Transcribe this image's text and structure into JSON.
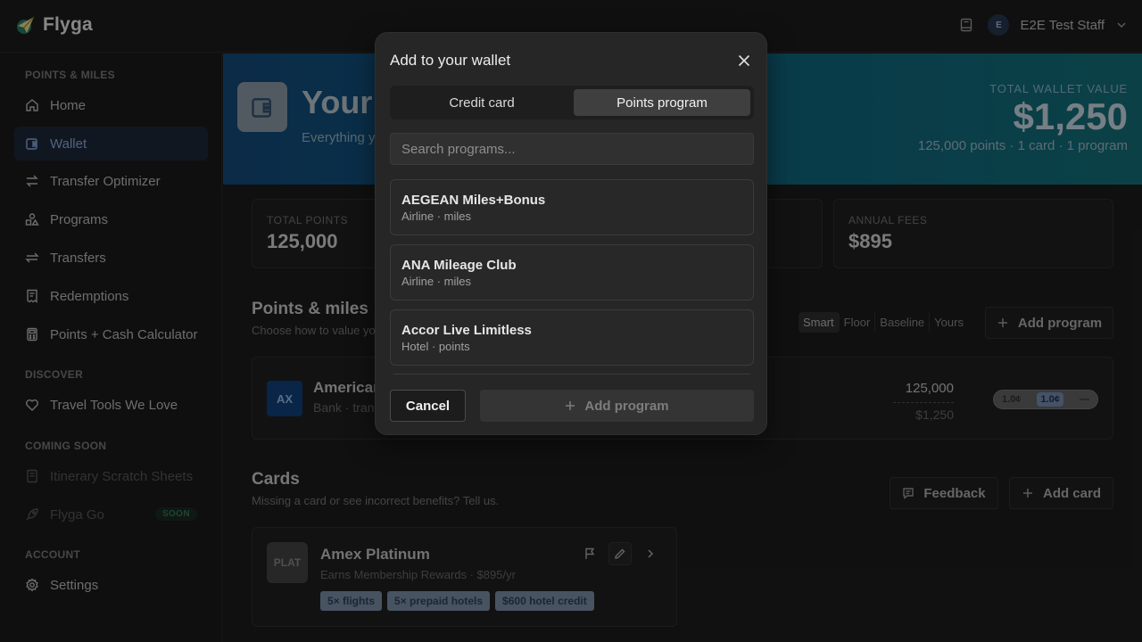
{
  "brand": {
    "name": "Flyga",
    "logo_icon": "paper-plane-globe-icon"
  },
  "topbar": {
    "user_initial": "E",
    "user_name": "E2E Test Staff"
  },
  "sidebar": {
    "sections": [
      {
        "title": "POINTS & MILES"
      },
      {
        "title": "DISCOVER"
      },
      {
        "title": "COMING SOON"
      },
      {
        "title": "ACCOUNT"
      }
    ],
    "items": [
      {
        "label": "Home",
        "icon": "home-icon"
      },
      {
        "label": "Wallet",
        "icon": "wallet-icon",
        "active": true
      },
      {
        "label": "Transfer Optimizer",
        "icon": "arrows-exchange-icon"
      },
      {
        "label": "Programs",
        "icon": "shapes-icon"
      },
      {
        "label": "Transfers",
        "icon": "transfer-icon"
      },
      {
        "label": "Redemptions",
        "icon": "receipt-icon"
      },
      {
        "label": "Points + Cash Calculator",
        "icon": "calculator-icon"
      },
      {
        "label": "Travel Tools We Love",
        "icon": "heart-icon"
      },
      {
        "label": "Itinerary Scratch Sheets",
        "icon": "notebook-icon"
      },
      {
        "label": "Flyga Go",
        "icon": "rocket-icon",
        "badge": "SOON"
      },
      {
        "label": "Settings",
        "icon": "gear-icon"
      }
    ]
  },
  "hero": {
    "title": "Your",
    "subtitle": "Everything y",
    "value_label": "TOTAL WALLET VALUE",
    "value": "$1,250",
    "detail": "125,000 points · 1 card · 1 program"
  },
  "stats": [
    {
      "label": "TOTAL POINTS",
      "value": "125,000"
    },
    {
      "label": "ANNUAL FEES",
      "value": "$895"
    }
  ],
  "points_section": {
    "title": "Points & miles",
    "subtitle": "Choose how to value yo",
    "modes": [
      "Smart",
      "Floor",
      "Baseline",
      "Yours"
    ],
    "active_mode": "Smart",
    "add_label": "Add program",
    "program": {
      "badge": "AX",
      "name": "American",
      "kind": "Bank · tran",
      "points": "125,000",
      "cash": "$1,250",
      "rates": [
        "1.0¢",
        "1.0¢",
        "—"
      ]
    }
  },
  "cards_section": {
    "title": "Cards",
    "subtitle": "Missing a card or see incorrect benefits? Tell us.",
    "feedback_label": "Feedback",
    "add_label": "Add card",
    "card": {
      "badge": "PLAT",
      "name": "Amex Platinum",
      "earn": "Earns Membership Rewards · $895/yr",
      "tags": [
        "5× flights",
        "5× prepaid hotels",
        "$600 hotel credit"
      ]
    }
  },
  "modal": {
    "title": "Add to your wallet",
    "tabs": [
      "Credit card",
      "Points program"
    ],
    "active_tab": "Points program",
    "search_placeholder": "Search programs...",
    "programs": [
      {
        "name": "AEGEAN Miles+Bonus",
        "meta": "Airline · miles"
      },
      {
        "name": "ANA Mileage Club",
        "meta": "Airline · miles"
      },
      {
        "name": "Accor Live Limitless",
        "meta": "Hotel · points"
      }
    ],
    "cancel_label": "Cancel",
    "add_label": "Add program"
  }
}
